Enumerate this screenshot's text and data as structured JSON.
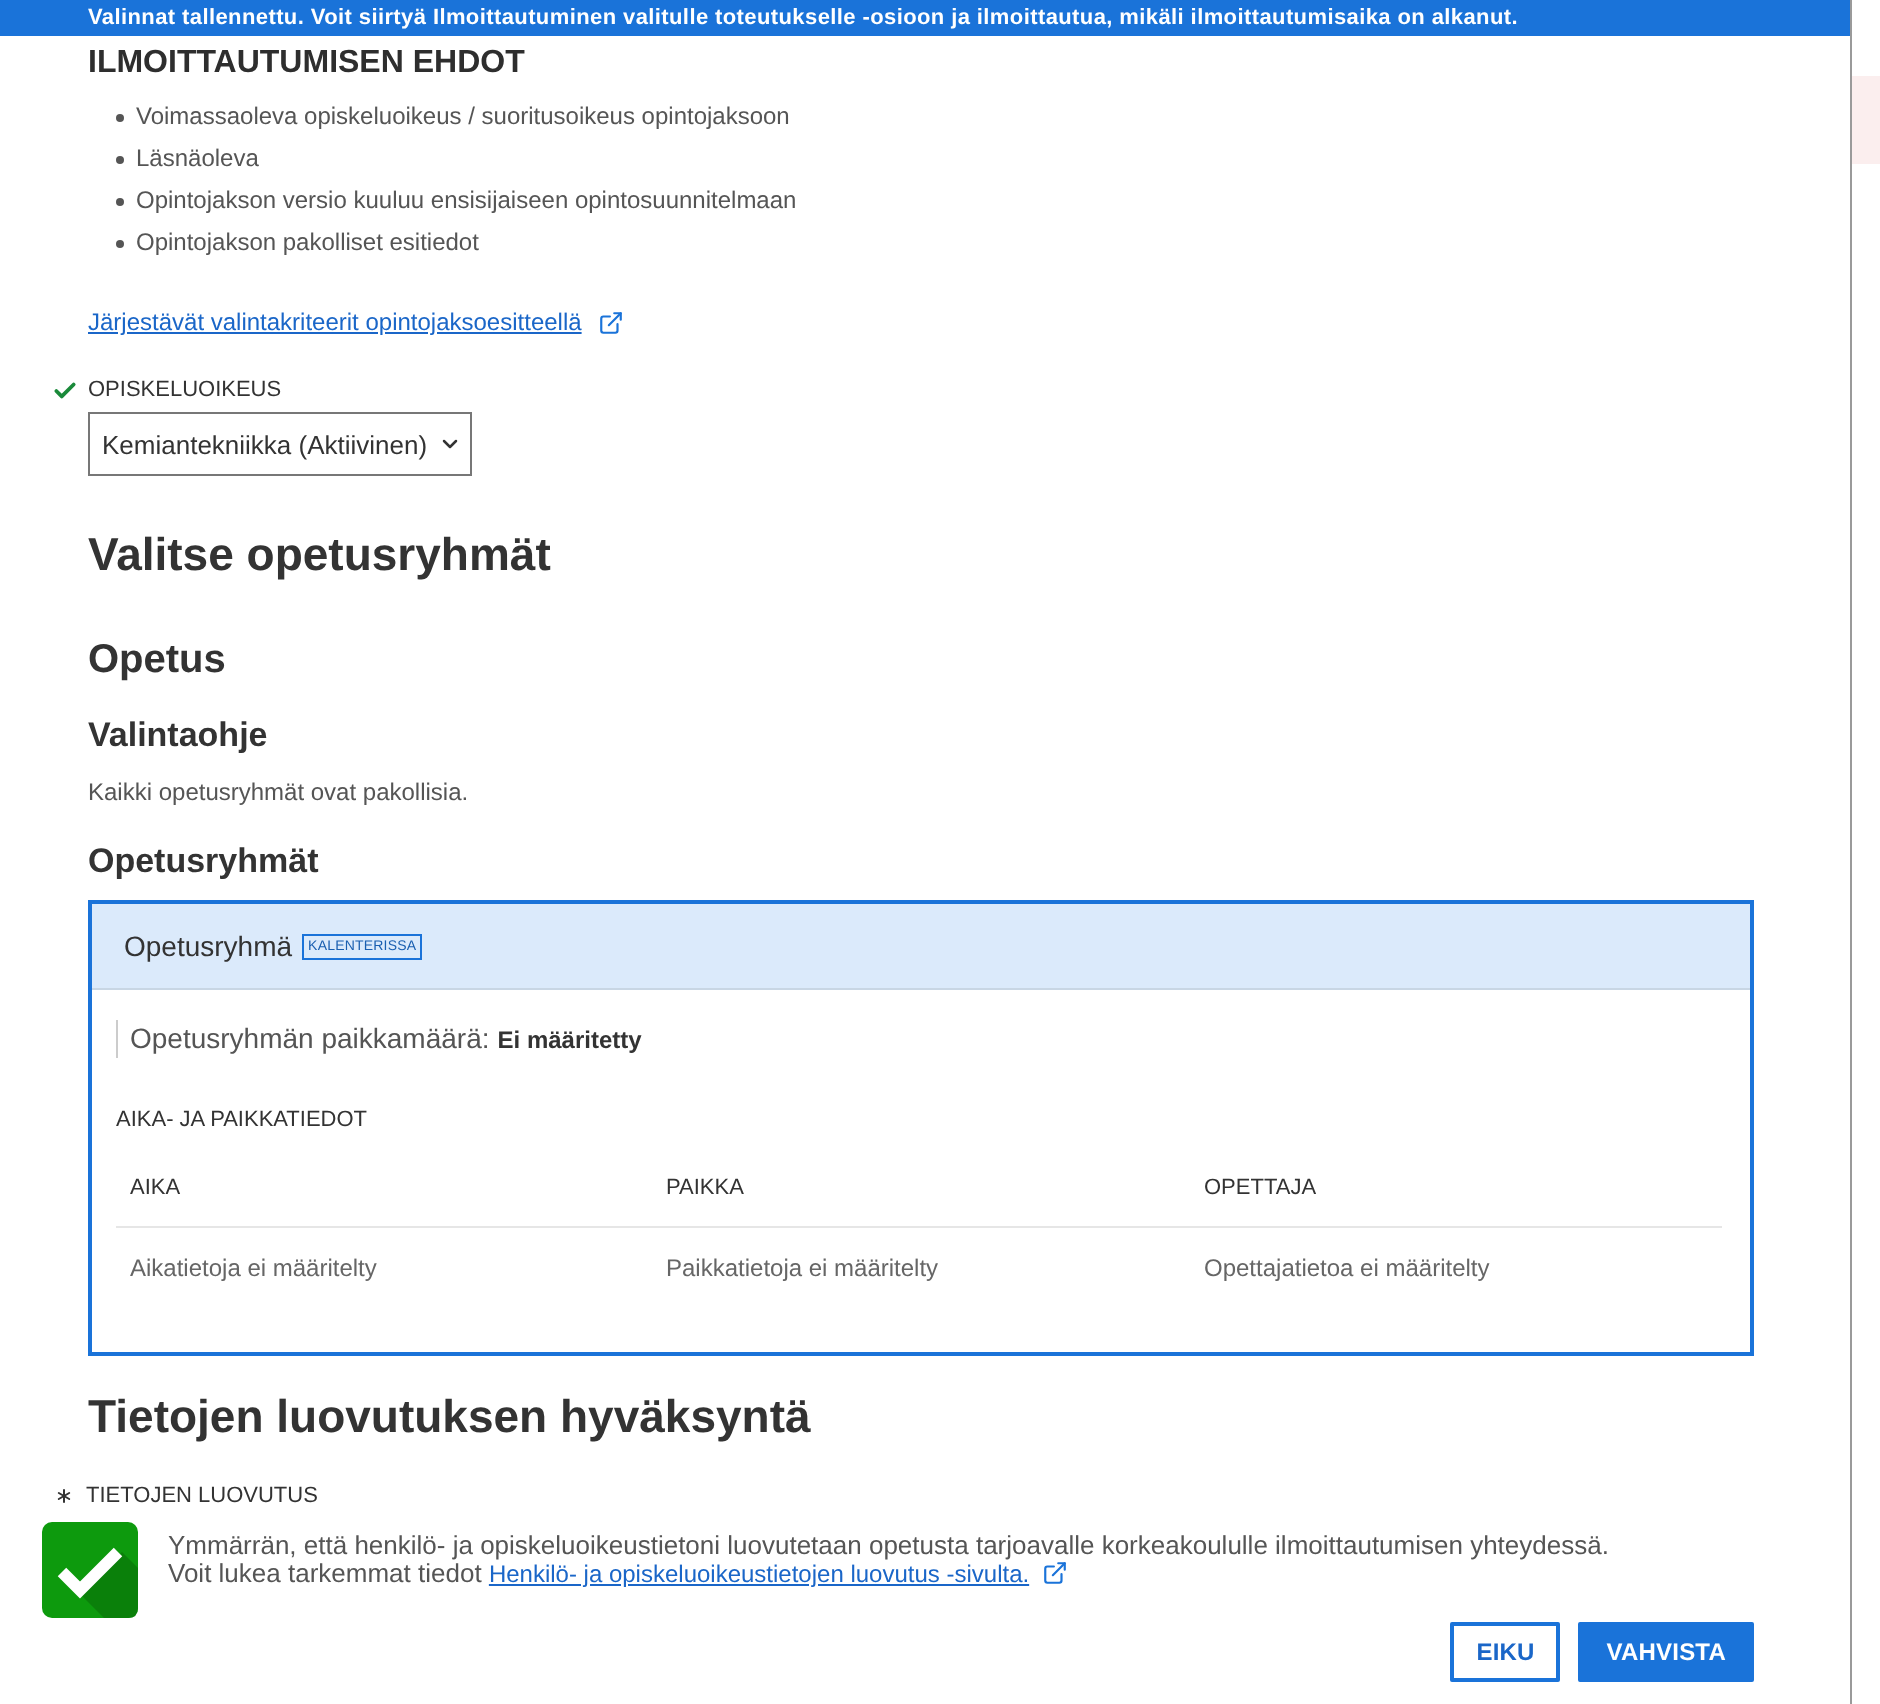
{
  "banner": {
    "text": "Valinnat tallennettu. Voit siirtyä Ilmoittautuminen valitulle toteutukselle -osioon ja ilmoittautua, mikäli ilmoittautumisaika on alkanut."
  },
  "conditions": {
    "title": "ILMOITTAUTUMISEN EHDOT",
    "items": [
      "Voimassaoleva opiskeluoikeus / suoritusoikeus opintojaksoon",
      "Läsnäoleva",
      "Opintojakson versio kuuluu ensisijaiseen opintosuunnitelmaan",
      "Opintojakson pakolliset esitiedot"
    ],
    "link": "Järjestävät valintakriteerit opintojaksoesitteellä"
  },
  "study_right": {
    "label": "OPISKELUOIKEUS",
    "valid": true,
    "value": "Kemiantekniikka (Aktiivinen)"
  },
  "heading": "Valitse opetusryhmät",
  "section": {
    "title": "Opetus",
    "guide_title": "Valintaohje",
    "guide_text": "Kaikki opetusryhmät ovat pakollisia.",
    "groups_title": "Opetusryhmät"
  },
  "group_card": {
    "title": "Opetusryhmä",
    "badge": "KALENTERISSA",
    "capacity_label": "Opetusryhmän paikkamäärä:",
    "capacity_value": "Ei määritetty",
    "schedule_title": "AIKA- JA PAIKKATIEDOT",
    "columns": [
      "AIKA",
      "PAIKKA",
      "OPETTAJA"
    ],
    "rows": [
      {
        "cells": [
          "Aikatietoja ei määritelty",
          "Paikkatietoja ei määritelty",
          "Opettajatietoa ei määritelty"
        ]
      }
    ]
  },
  "consent": {
    "title": "Tietojen luovutuksen hyväksyntä",
    "label": "TIETOJEN LUOVUTUS",
    "required": true,
    "checked": true,
    "text": "Ymmärrän, että henkilö- ja opiskeluoikeustietoni luovutetaan opetusta tarjoavalle korkeakoululle ilmoittautumisen yhteydessä.",
    "more_text": "Voit lukea tarkemmat tiedot",
    "link": "Henkilö- ja opiskeluoikeustietojen luovutus -sivulta."
  },
  "buttons": [
    {
      "label": "EIKU",
      "kind": "secondary"
    },
    {
      "label": "VAHVISTA",
      "kind": "primary"
    }
  ]
}
